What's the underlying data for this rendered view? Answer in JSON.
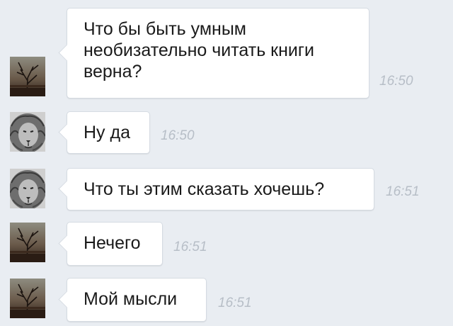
{
  "messages": [
    {
      "sender": "dark-avatar",
      "text": "Что бы быть умным\nнеобизательно читать книги\nверна?",
      "time": "16:50"
    },
    {
      "sender": "lion-avatar",
      "text": "Ну да",
      "time": "16:50"
    },
    {
      "sender": "lion-avatar",
      "text": "Что ты этим сказать хочешь?",
      "time": "16:51"
    },
    {
      "sender": "dark-avatar",
      "text": "Нечего",
      "time": "16:51"
    },
    {
      "sender": "dark-avatar",
      "text": "Мой мысли",
      "time": "16:51"
    }
  ],
  "colors": {
    "background": "#e9edf2",
    "bubble": "#ffffff",
    "bubble_border": "#d5dbe2",
    "time": "#b7bec7",
    "text": "#1a1a1a"
  }
}
